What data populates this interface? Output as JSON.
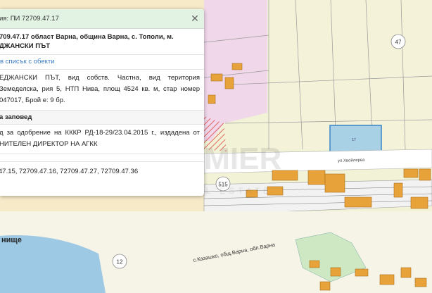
{
  "map": {
    "watermark_text": "PREMIER",
    "watermark_sub": "REAL ESTATE",
    "labels": {
      "road_number_1": "515",
      "road_number_2": "12",
      "parcel_47": "47",
      "parcel_17": "17",
      "street_1": "ул.Хвойлерва",
      "street_2": "с.Казашко, общ.Варна, обл.Варна",
      "place_partial": "нище"
    }
  },
  "panel": {
    "header_title": "ия: ПИ 72709.47.17",
    "address_line1": "709.47.17 област Варна, община Варна, с. Тополи, м.",
    "address_line2": "ДЖАНСКИ ПЪТ",
    "add_to_list": "в списък с обекти",
    "description": "ЕДЖАНСКИ ПЪТ, вид собств. Частна, вид територия Земеделска, рия 5, НТП Нива, площ 4524 кв. м, стар номер 047017, Брой е: 9 бр.",
    "order_title": "а заповед",
    "order_text": "д за одобрение на КККР РД-18-29/23.04.2015 г., издадена от НИТЕЛЕН ДИРЕКТОР НА АГКК",
    "neighbours": "47.15, 72709.47.16, 72709.47.27, 72709.47.36"
  }
}
